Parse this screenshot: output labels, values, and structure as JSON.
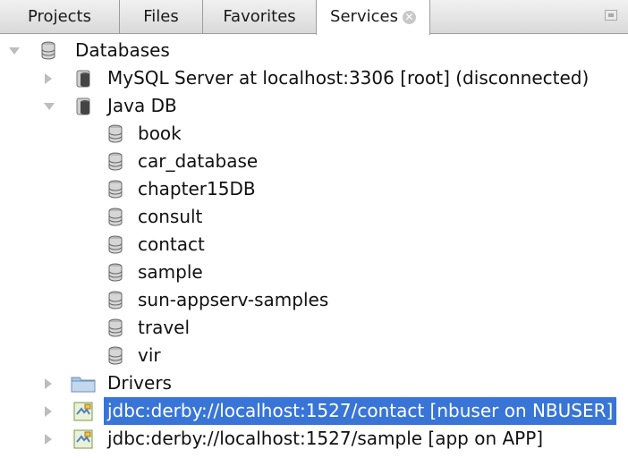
{
  "tabs": [
    {
      "label": "Projects"
    },
    {
      "label": "Files"
    },
    {
      "label": "Favorites"
    },
    {
      "label": "Services",
      "close_icon": "close-icon"
    }
  ],
  "active_tab": "Services",
  "tree": {
    "databases_label": "Databases",
    "mysql_label": "MySQL Server at localhost:3306 [root] (disconnected)",
    "javadb_label": "Java DB",
    "javadb_children": [
      "book",
      "car_database",
      "chapter15DB",
      "consult",
      "contact",
      "sample",
      "sun-appserv-samples",
      "travel",
      "vir"
    ],
    "drivers_label": "Drivers",
    "connections": [
      {
        "label": "jdbc:derby://localhost:1527/contact [nbuser on NBUSER]",
        "selected": true
      },
      {
        "label": "jdbc:derby://localhost:1527/sample [app on APP]",
        "selected": false
      }
    ]
  },
  "colors": {
    "selection": "#3875d7",
    "tabbar": "#d9d9d9",
    "folder": "#a9c6e6"
  }
}
